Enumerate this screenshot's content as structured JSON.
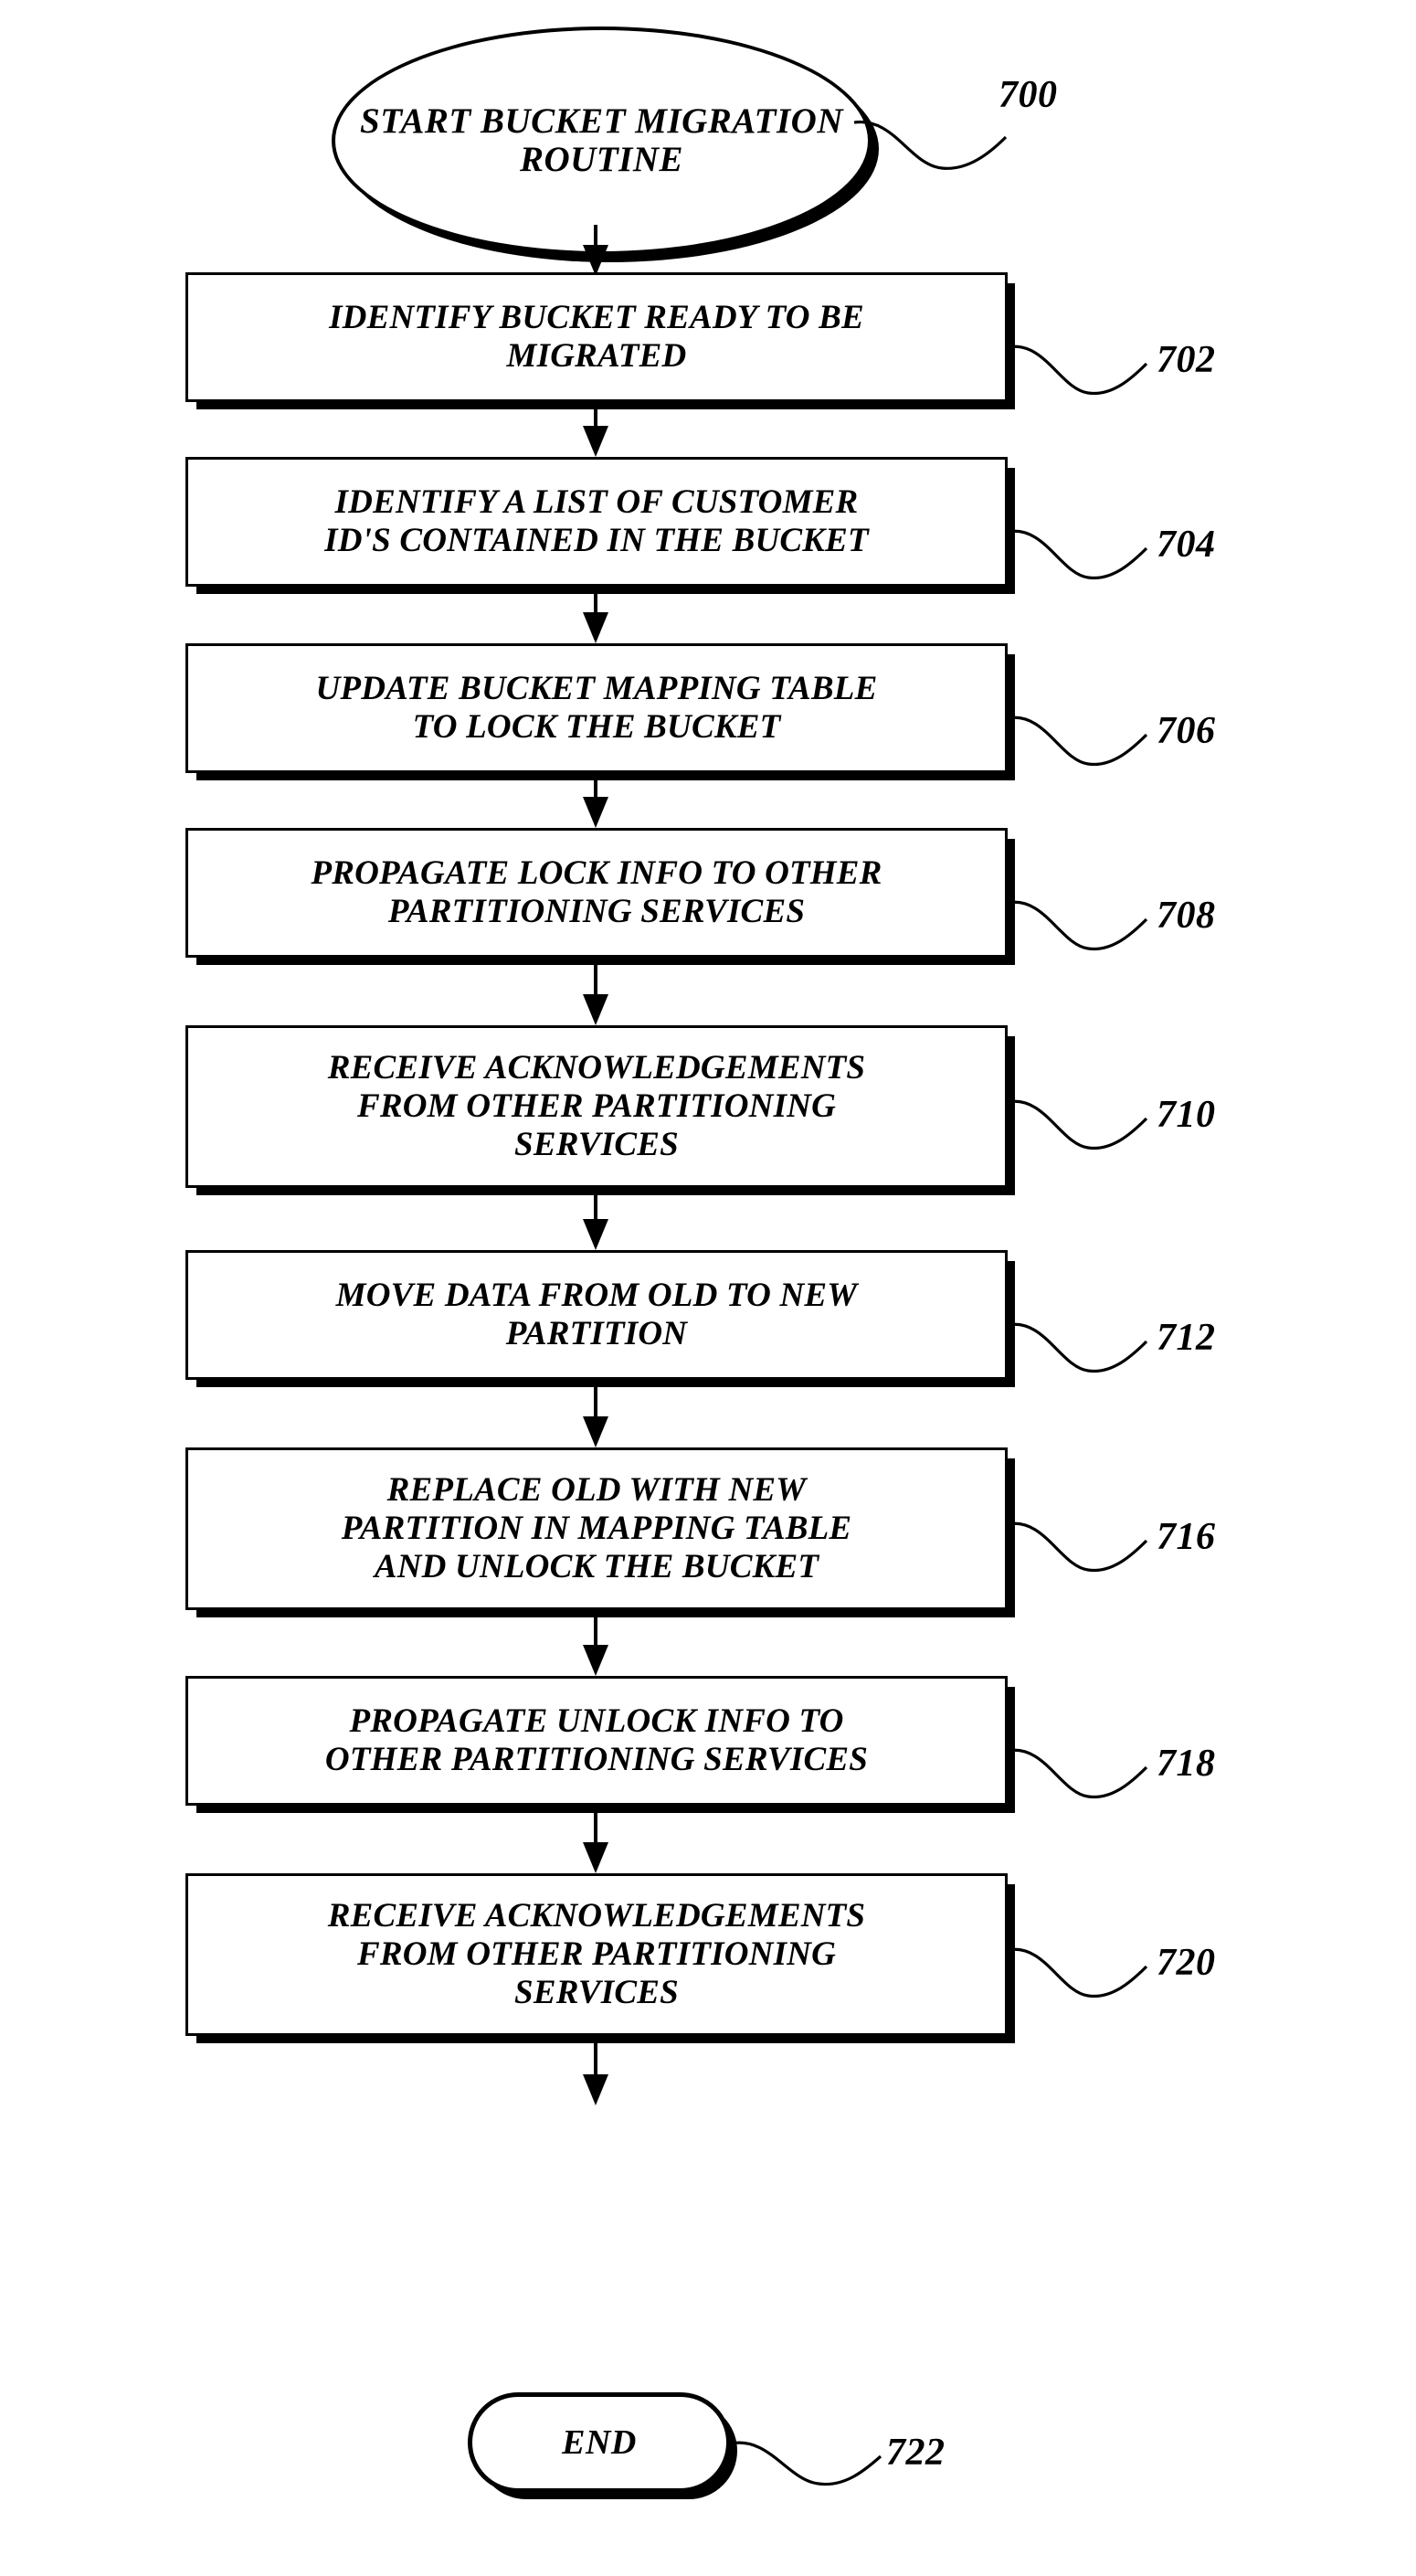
{
  "figure": {
    "type": "patent-flowchart",
    "title": "BUCKET MIGRATION ROUTINE",
    "orientation": "vertical-top-to-bottom"
  },
  "nodes": [
    {
      "id": "start",
      "shape": "ellipse",
      "ref": "700",
      "text": "START\nBUCKET MIGRATION\nROUTINE",
      "lines": [
        "START",
        "BUCKET MIGRATION",
        "ROUTINE"
      ]
    },
    {
      "id": "step702",
      "shape": "rectangle",
      "ref": "702",
      "text": "IDENTIFY BUCKET READY TO BE\nMIGRATED",
      "lines": [
        "IDENTIFY BUCKET READY TO BE",
        "MIGRATED"
      ]
    },
    {
      "id": "step704",
      "shape": "rectangle",
      "ref": "704",
      "text": "IDENTIFY A LIST OF CUSTOMER\nID'S CONTAINED IN THE BUCKET",
      "lines": [
        "IDENTIFY A LIST OF CUSTOMER",
        "ID'S CONTAINED IN THE BUCKET"
      ]
    },
    {
      "id": "step706",
      "shape": "rectangle",
      "ref": "706",
      "text": "UPDATE  BUCKET MAPPING TABLE\nTO LOCK THE BUCKET",
      "lines": [
        "UPDATE  BUCKET MAPPING TABLE",
        "TO LOCK THE BUCKET"
      ]
    },
    {
      "id": "step708",
      "shape": "rectangle",
      "ref": "708",
      "text": "PROPAGATE LOCK INFO TO OTHER\nPARTITIONING SERVICES",
      "lines": [
        "PROPAGATE LOCK INFO TO OTHER",
        "PARTITIONING SERVICES"
      ]
    },
    {
      "id": "step710",
      "shape": "rectangle",
      "ref": "710",
      "text": "RECEIVE ACKNOWLEDGEMENTS\nFROM OTHER PARTITIONING\nSERVICES",
      "lines": [
        "RECEIVE ACKNOWLEDGEMENTS",
        "FROM OTHER PARTITIONING",
        "SERVICES"
      ]
    },
    {
      "id": "step712",
      "shape": "rectangle",
      "ref": "712",
      "text": "MOVE DATA FROM OLD TO NEW\nPARTITION",
      "lines": [
        "MOVE DATA FROM OLD TO NEW",
        "PARTITION"
      ]
    },
    {
      "id": "step716",
      "shape": "rectangle",
      "ref": "716",
      "text": "REPLACE OLD WITH NEW\nPARTITION IN MAPPING TABLE\nAND UNLOCK THE BUCKET",
      "lines": [
        "REPLACE OLD WITH NEW",
        "PARTITION IN MAPPING TABLE",
        "AND UNLOCK THE BUCKET"
      ]
    },
    {
      "id": "step718",
      "shape": "rectangle",
      "ref": "718",
      "text": "PROPAGATE UNLOCK INFO TO\nOTHER PARTITIONING SERVICES",
      "lines": [
        "PROPAGATE UNLOCK INFO TO",
        "OTHER PARTITIONING SERVICES"
      ]
    },
    {
      "id": "step720",
      "shape": "rectangle",
      "ref": "720",
      "text": "RECEIVE ACKNOWLEDGEMENTS\nFROM OTHER PARTITIONING\nSERVICES",
      "lines": [
        "RECEIVE ACKNOWLEDGEMENTS",
        "FROM OTHER PARTITIONING",
        "SERVICES"
      ]
    },
    {
      "id": "end",
      "shape": "stadium",
      "ref": "722",
      "text": "END",
      "lines": [
        "END"
      ]
    }
  ],
  "refs": {
    "start": "700",
    "step702": "702",
    "step704": "704",
    "step706": "706",
    "step708": "708",
    "step710": "710",
    "step712": "712",
    "step716": "716",
    "step718": "718",
    "step720": "720",
    "end": "722"
  },
  "colors": {
    "stroke": "#000000",
    "fill": "#ffffff",
    "shadow": "#000000"
  }
}
